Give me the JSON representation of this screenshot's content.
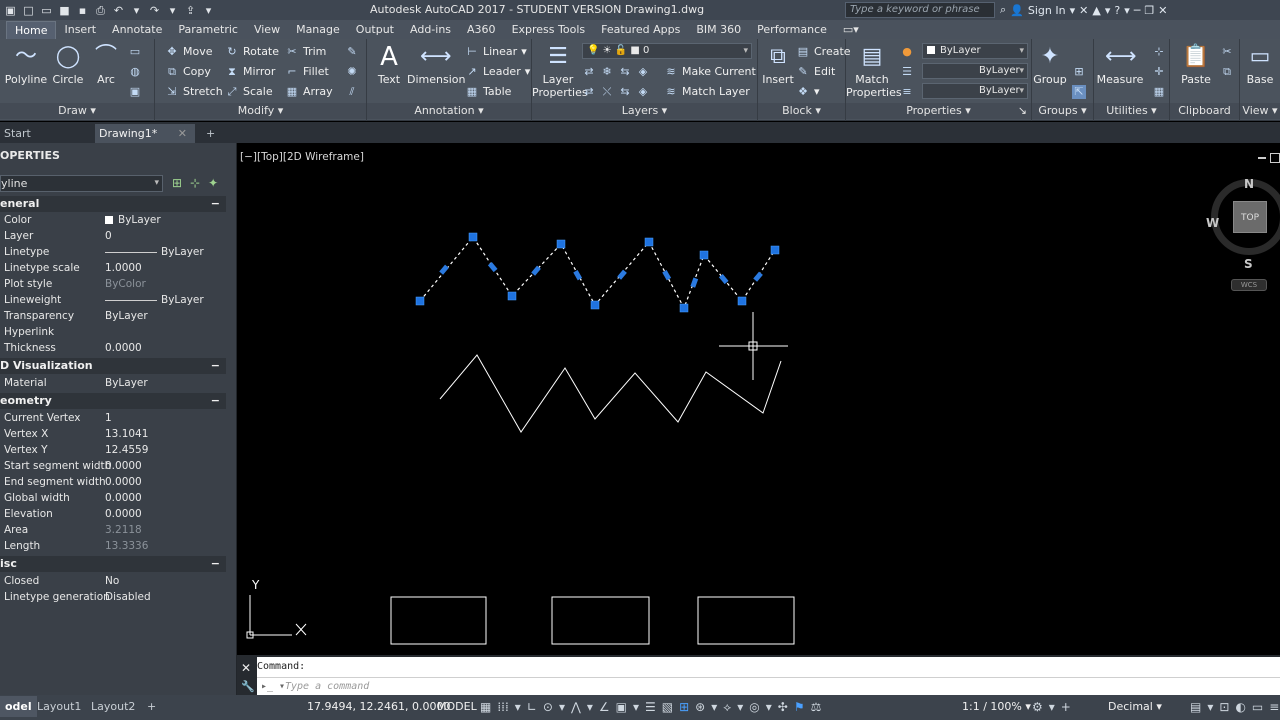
{
  "titlebar": {
    "title": "Autodesk AutoCAD 2017 - STUDENT VERSION    Drawing1.dwg",
    "search_placeholder": "Type a keyword or phrase",
    "sign_in": "Sign In"
  },
  "ribbon_tabs": [
    "Home",
    "Insert",
    "Annotate",
    "Parametric",
    "View",
    "Manage",
    "Output",
    "Add-ins",
    "A360",
    "Express Tools",
    "Featured Apps",
    "BIM 360",
    "Performance"
  ],
  "draw_panel": {
    "label": "Draw",
    "polyline": "Polyline",
    "circle": "Circle",
    "arc": "Arc"
  },
  "modify_panel": {
    "label": "Modify",
    "move": "Move",
    "rotate": "Rotate",
    "trim": "Trim",
    "copy": "Copy",
    "mirror": "Mirror",
    "fillet": "Fillet",
    "stretch": "Stretch",
    "scale": "Scale",
    "array": "Array"
  },
  "annotation_panel": {
    "label": "Annotation",
    "text": "Text",
    "dimension": "Dimension",
    "linear": "Linear",
    "leader": "Leader",
    "table": "Table"
  },
  "layers_panel": {
    "label": "Layers",
    "layer_properties_1": "Layer",
    "layer_properties_2": "Properties",
    "current_layer": "0",
    "make_current": "Make Current",
    "match_layer": "Match Layer"
  },
  "block_panel": {
    "label": "Block",
    "insert": "Insert",
    "create": "Create",
    "edit": "Edit"
  },
  "properties_panel": {
    "label": "Properties",
    "match_1": "Match",
    "match_2": "Properties",
    "color": "ByLayer",
    "linetype": "ByLayer",
    "lineweight": "ByLayer"
  },
  "groups_panel": {
    "label": "Groups",
    "group": "Group"
  },
  "utilities_panel": {
    "label": "Utilities",
    "measure": "Measure"
  },
  "clipboard_panel": {
    "label": "Clipboard",
    "paste": "Paste"
  },
  "view_panel": {
    "label": "View",
    "base": "Base"
  },
  "file_tabs": {
    "start": "Start",
    "drawing": "Drawing1*",
    "add": "+"
  },
  "properties_palette": {
    "title": "OPERTIES",
    "object_type": "yline",
    "sections": {
      "general": "eneral",
      "visualization": "D Visualization",
      "geometry": "eometry",
      "misc": "isc"
    },
    "general": [
      {
        "k": "Color",
        "v": "ByLayer"
      },
      {
        "k": "Layer",
        "v": "0"
      },
      {
        "k": "Linetype",
        "v": "ByLayer"
      },
      {
        "k": "Linetype scale",
        "v": "1.0000"
      },
      {
        "k": "Plot style",
        "v": "ByColor"
      },
      {
        "k": "Lineweight",
        "v": "ByLayer"
      },
      {
        "k": "Transparency",
        "v": "ByLayer"
      },
      {
        "k": "Hyperlink",
        "v": ""
      },
      {
        "k": "Thickness",
        "v": "0.0000"
      }
    ],
    "visualization": [
      {
        "k": "Material",
        "v": "ByLayer"
      }
    ],
    "geometry": [
      {
        "k": "Current Vertex",
        "v": "1"
      },
      {
        "k": "Vertex X",
        "v": "13.1041"
      },
      {
        "k": "Vertex Y",
        "v": "12.4559"
      },
      {
        "k": "Start segment width",
        "v": "0.0000"
      },
      {
        "k": "End segment width",
        "v": "0.0000"
      },
      {
        "k": "Global width",
        "v": "0.0000"
      },
      {
        "k": "Elevation",
        "v": "0.0000"
      },
      {
        "k": "Area",
        "v": "3.2118"
      },
      {
        "k": "Length",
        "v": "13.3336"
      }
    ],
    "misc": [
      {
        "k": "Closed",
        "v": "No"
      },
      {
        "k": "Linetype generation",
        "v": "Disabled"
      }
    ]
  },
  "viewport": {
    "label": "[−][Top][2D Wireframe]",
    "viewcube": {
      "top": "TOP",
      "n": "N",
      "s": "S",
      "w": "W",
      "wcs": "WCS"
    },
    "ucs": {
      "x": "X",
      "y": "Y"
    }
  },
  "command": {
    "history": "Command:",
    "placeholder": "Type a command"
  },
  "statusbar": {
    "layout_tabs": [
      "odel",
      "Layout1",
      "Layout2"
    ],
    "coords": "17.9494, 12.2461, 0.0000",
    "model": "MODEL",
    "annotation_scale": "1:1 / 100%",
    "units": "Decimal"
  }
}
